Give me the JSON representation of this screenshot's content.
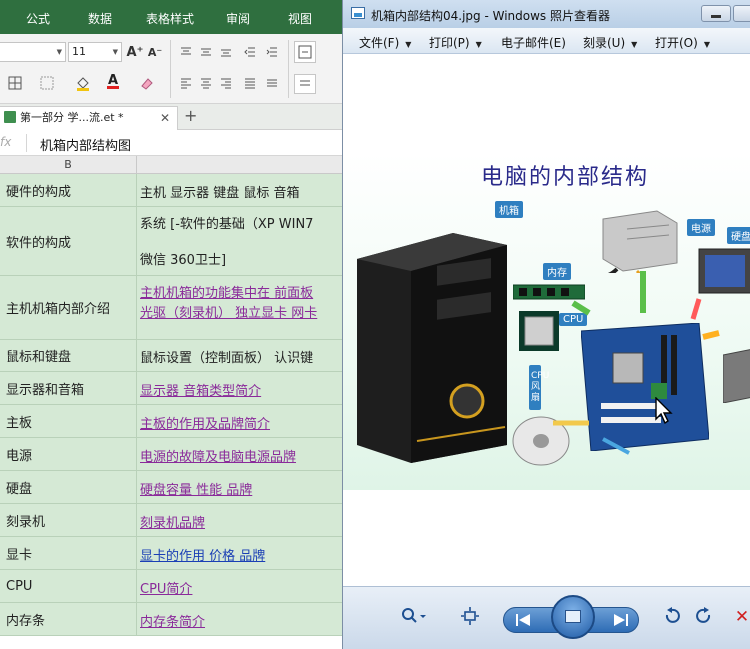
{
  "spreadsheet": {
    "ribbon_tabs": [
      "公式",
      "数据",
      "表格样式",
      "审阅",
      "视图"
    ],
    "font_size": "11",
    "doc_tab": "第一部分 学...流.et *",
    "fx_label": "fx",
    "formula_value": "机箱内部结构图",
    "column_header": "B",
    "rows": [
      {
        "label": "硬件的构成",
        "lines": [
          "主机 显示器 键盘 鼠标 音箱"
        ],
        "link": false
      },
      {
        "label": "软件的构成",
        "lines": [
          "系统 [-软件的基础（XP WIN7",
          "微信 360卫士]"
        ],
        "link": false
      },
      {
        "label": "主机机箱内部介绍",
        "lines": [
          "主机机箱的功能集中在 前面板",
          "光驱（刻录机） 独立显卡 网卡"
        ],
        "link": true,
        "blue": false
      },
      {
        "label": "鼠标和键盘",
        "lines": [
          "鼠标设置（控制面板）  认识键"
        ],
        "link": false
      },
      {
        "label": "显示器和音箱",
        "lines": [
          "显示器 音箱类型简介"
        ],
        "link": true,
        "blue": false
      },
      {
        "label": "主板",
        "lines": [
          "主板的作用及品牌简介"
        ],
        "link": true,
        "blue": false
      },
      {
        "label": "电源",
        "lines": [
          "电源的故障及电脑电源品牌"
        ],
        "link": true,
        "blue": false
      },
      {
        "label": "硬盘",
        "lines": [
          "硬盘容量 性能 品牌"
        ],
        "link": true,
        "blue": false
      },
      {
        "label": "刻录机",
        "lines": [
          " 刻录机品牌 "
        ],
        "link": true,
        "blue": false
      },
      {
        "label": "显卡",
        "lines": [
          "显卡的作用 价格 品牌"
        ],
        "link": true,
        "blue": true
      },
      {
        "label": "CPU",
        "lines": [
          "CPU简介"
        ],
        "link": true,
        "blue": false
      },
      {
        "label": "内存条",
        "lines": [
          "内存条简介"
        ],
        "link": true,
        "blue": false
      }
    ]
  },
  "viewer": {
    "title": "机箱内部结构04.jpg - Windows 照片查看器",
    "menus": [
      "文件(F)",
      "打印(P)",
      "电子邮件(E)",
      "刻录(U)",
      "打开(O)"
    ],
    "image": {
      "title": "电脑的内部结构",
      "tags": {
        "case": "机箱",
        "power": "电源",
        "memory": "内存",
        "cpu": "CPU",
        "disk": "硬盘",
        "cooler": "CPU风扇"
      }
    },
    "controls": {
      "zoom": "zoom-icon",
      "fit": "fit-window-icon",
      "prev": "previous-icon",
      "slideshow": "slideshow-icon",
      "next": "next-icon",
      "rotate_ccw": "rotate-left-icon",
      "rotate_cw": "rotate-right-icon",
      "delete": "delete-icon"
    }
  }
}
